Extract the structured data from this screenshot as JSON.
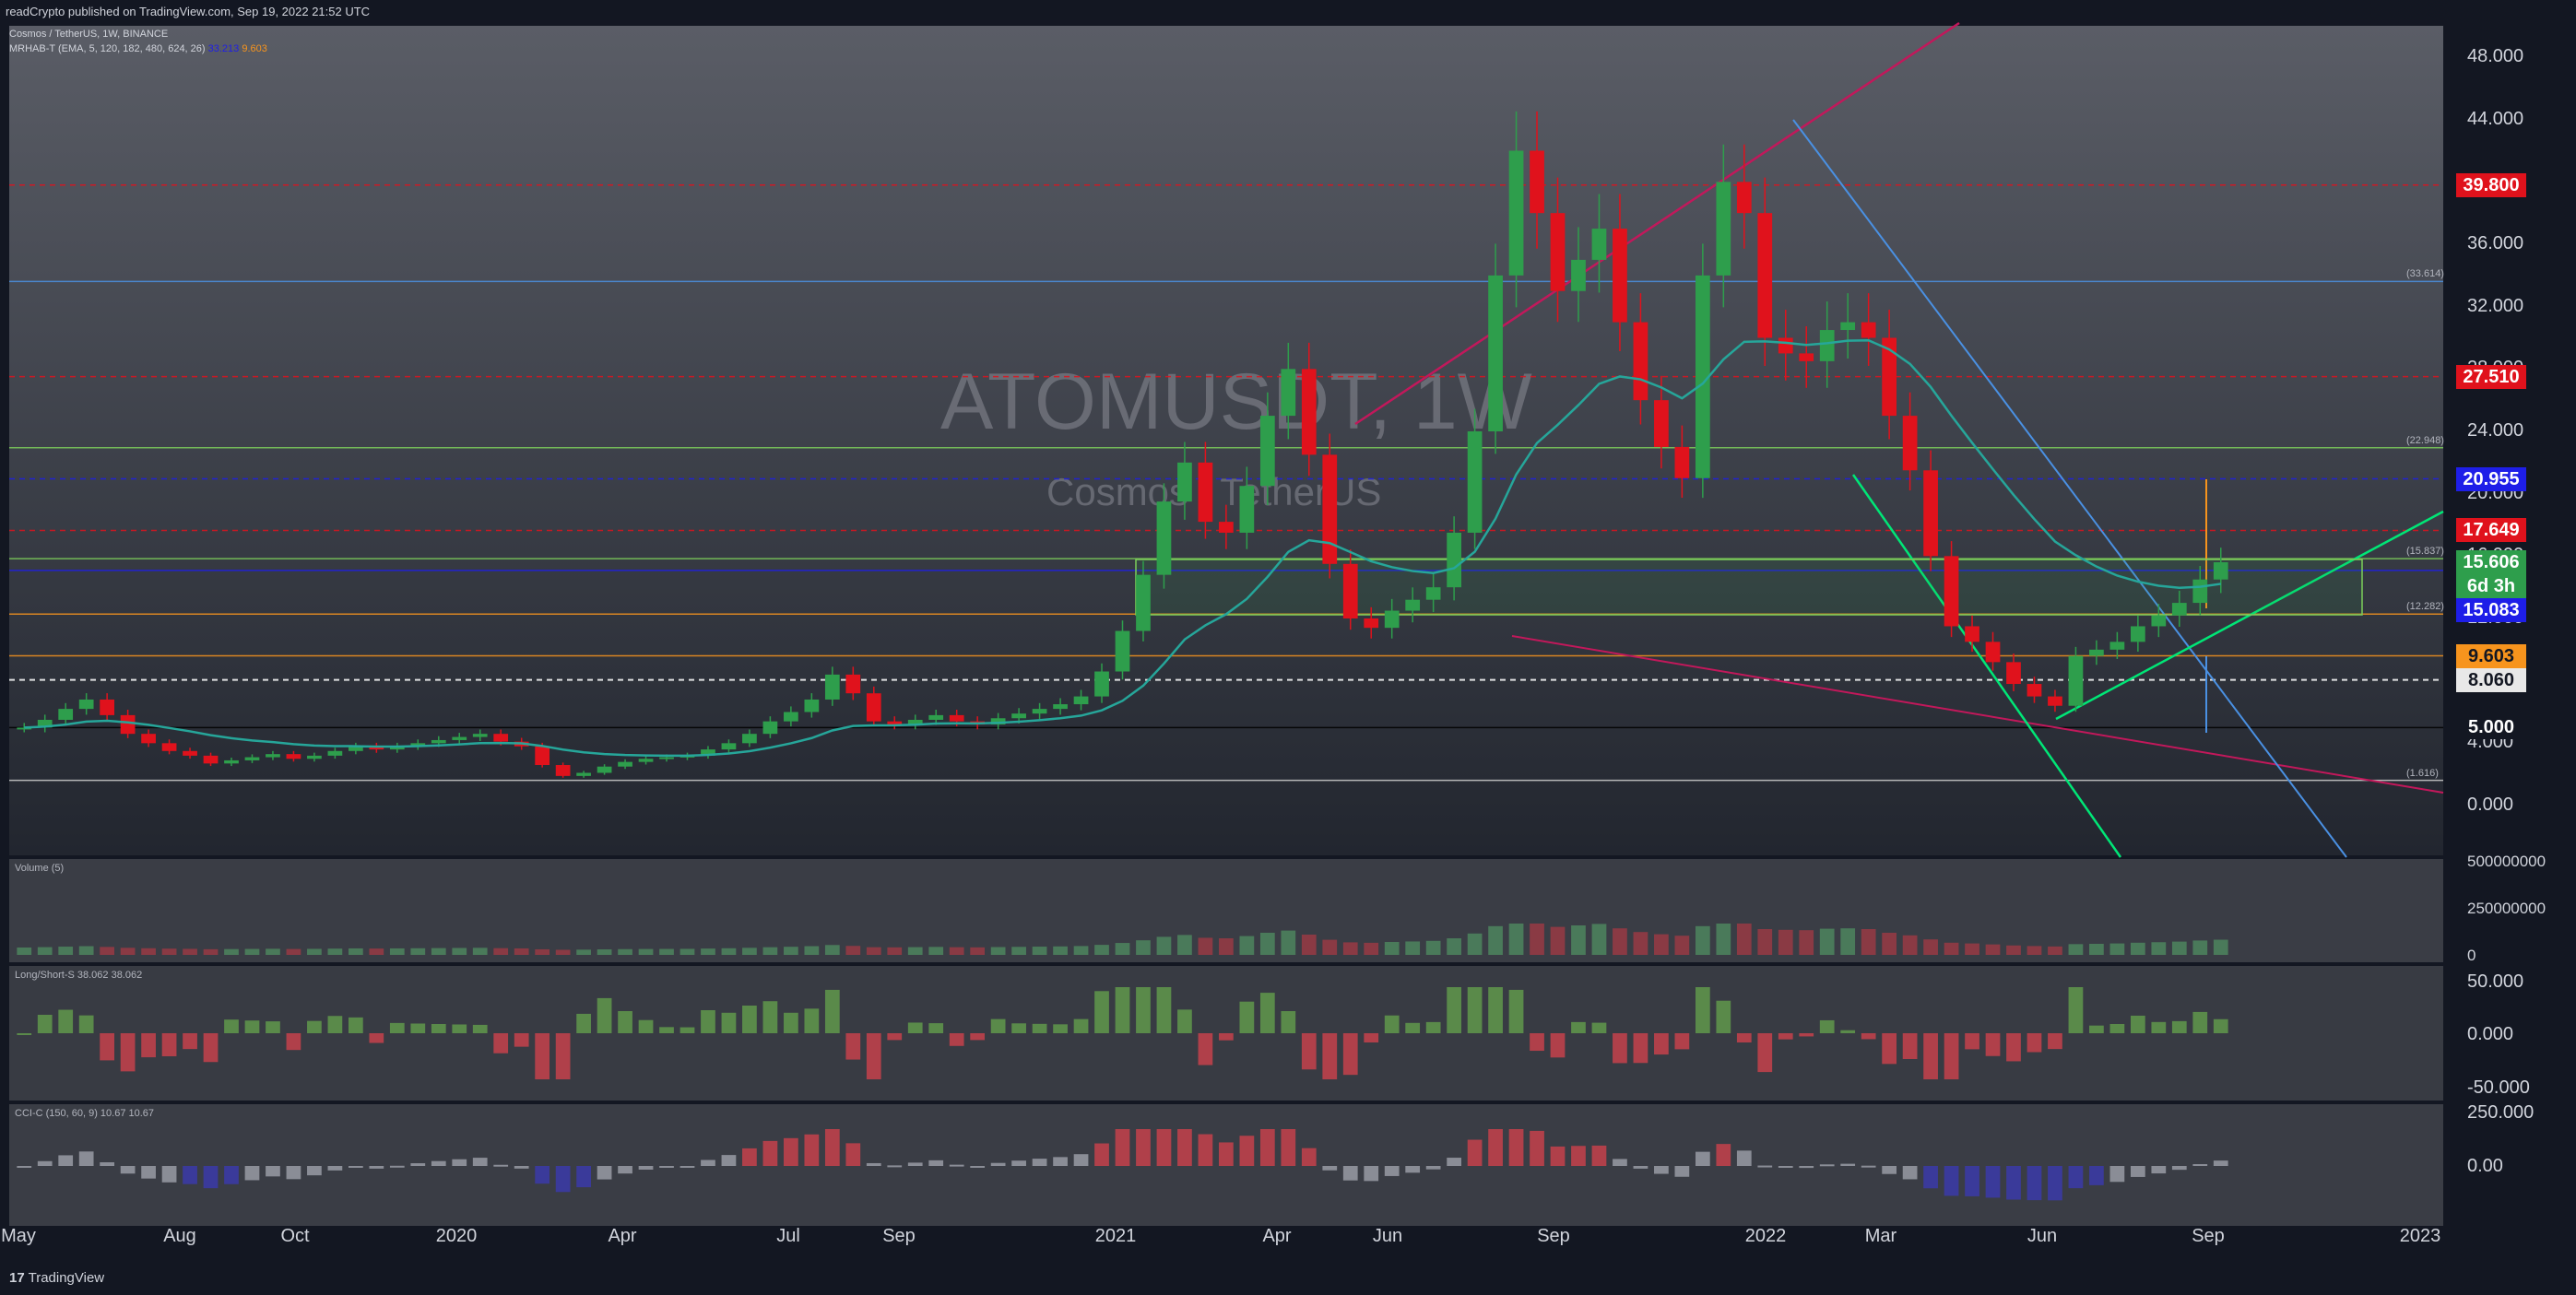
{
  "header": {
    "publisher": "readCrypto published on TradingView.com, Sep 19, 2022 21:52 UTC"
  },
  "legend": {
    "pair_line": "Cosmos / TetherUS, 1W, BINANCE",
    "indicator_line": "MRHAB-T (EMA, 5, 120, 182, 480, 624, 26)",
    "indicator_values": [
      "33.213",
      "9.603"
    ]
  },
  "watermark": {
    "symbol": "ATOMUSDT, 1W",
    "name": "Cosmos / TetherUS"
  },
  "price_axis": {
    "ticks": [
      "48.000",
      "44.000",
      "40.000",
      "36.000",
      "32.000",
      "28.000",
      "24.000",
      "20.000",
      "16.000",
      "12.000",
      "8.000",
      "4.000",
      "0.000"
    ],
    "tags": [
      {
        "label": "39.800",
        "bg": "#e0121c",
        "fg": "#ffffff"
      },
      {
        "label": "27.510",
        "bg": "#e0121c",
        "fg": "#ffffff"
      },
      {
        "label": "20.955",
        "bg": "#1e1ee8",
        "fg": "#ffffff"
      },
      {
        "label": "17.649",
        "bg": "#e0121c",
        "fg": "#ffffff"
      },
      {
        "label": "15.606",
        "bg": "#2e9e4c",
        "fg": "#ffffff"
      },
      {
        "label": "6d 3h",
        "bg": "#2e9e4c",
        "fg": "#ffffff"
      },
      {
        "label": "15.083",
        "bg": "#1e1ee8",
        "fg": "#ffffff"
      },
      {
        "label": "9.603",
        "bg": "#f7941d",
        "fg": "#131722"
      },
      {
        "label": "8.060",
        "bg": "#e8e8e8",
        "fg": "#131722"
      },
      {
        "label": "5.000",
        "bg": "#131722",
        "fg": "#ffffff"
      }
    ],
    "level_labels": [
      "(33.614)",
      "(22.948)",
      "(15.837)",
      "(12.282)",
      "(1.616)"
    ]
  },
  "time_axis": {
    "ticks": [
      "May",
      "Aug",
      "Oct",
      "2020",
      "Apr",
      "Jul",
      "Sep",
      "2021",
      "Apr",
      "Jun",
      "Sep",
      "2022",
      "Mar",
      "Jun",
      "Sep",
      "2023"
    ]
  },
  "volume_panel": {
    "legend": "Volume (5)",
    "ticks": [
      "500000000",
      "250000000",
      "0"
    ]
  },
  "longshort_panel": {
    "legend": "Long/Short-S 38.062 38.062",
    "ticks": [
      "50.000",
      "0.000",
      "-50.000"
    ]
  },
  "cci_panel": {
    "legend": "CCI-C (150, 60, 9) 10.67 10.67",
    "ticks": [
      "250.000",
      "0.00"
    ]
  },
  "footer": {
    "brand": "TradingView"
  },
  "colors": {
    "background": "#131722",
    "up": "#2e9e4c",
    "down": "#e0121c",
    "accent_blue": "#1e1ee8",
    "accent_orange": "#f7941d"
  },
  "chart_data": {
    "type": "candlestick",
    "title": "ATOMUSDT, 1W",
    "symbol": "Cosmos / TetherUS",
    "exchange": "BINANCE",
    "interval": "1W",
    "ylim": [
      -2,
      50
    ],
    "horizontal_levels": [
      39.8,
      33.614,
      27.51,
      22.948,
      20.955,
      17.649,
      15.837,
      15.083,
      12.282,
      9.603,
      8.06,
      5.0,
      1.616
    ],
    "last_price": 15.606,
    "closes_approx": [
      5.0,
      5.5,
      6.2,
      6.8,
      5.8,
      4.6,
      4.0,
      3.5,
      3.2,
      2.7,
      2.9,
      3.1,
      3.3,
      3.0,
      3.2,
      3.5,
      3.8,
      3.6,
      3.8,
      4.0,
      4.2,
      4.4,
      4.6,
      4.1,
      3.8,
      2.6,
      1.9,
      2.1,
      2.5,
      2.8,
      3.0,
      3.1,
      3.2,
      3.6,
      4.0,
      4.6,
      5.4,
      6.0,
      6.8,
      8.4,
      7.2,
      5.4,
      5.2,
      5.5,
      5.8,
      5.4,
      5.2,
      5.6,
      5.9,
      6.2,
      6.5,
      7.0,
      8.6,
      11.2,
      14.8,
      19.5,
      22.0,
      18.2,
      17.5,
      20.5,
      25.0,
      28.0,
      22.5,
      15.5,
      12.0,
      11.4,
      12.5,
      13.2,
      14.0,
      17.5,
      24.0,
      34.0,
      42.0,
      38.0,
      33.0,
      35.0,
      37.0,
      31.0,
      26.0,
      23.0,
      21.0,
      34.0,
      40.0,
      38.0,
      30.0,
      29.0,
      28.5,
      30.5,
      31.0,
      30.0,
      25.0,
      21.5,
      16.0,
      11.5,
      10.5,
      9.2,
      7.8,
      7.0,
      6.4,
      9.6,
      10.0,
      10.5,
      11.5,
      12.2,
      13.0,
      14.5,
      15.606
    ]
  }
}
